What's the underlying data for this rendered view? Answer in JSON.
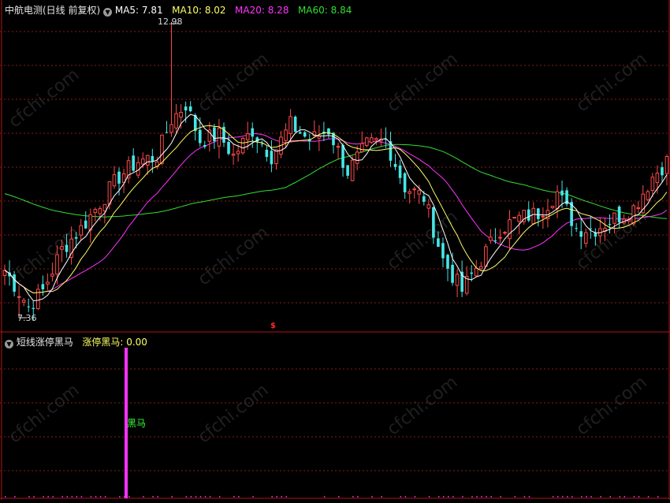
{
  "colors": {
    "background": "#000000",
    "grid": "#8a1c1c",
    "divider": "#b01515",
    "candle_up": "#ff4a4a",
    "candle_down": "#46e6e6",
    "ma5": "#ffffff",
    "ma10": "#ffff66",
    "ma20": "#ff33ff",
    "ma60": "#33dd33",
    "signal_bar": "#ff33ff",
    "signal_text": "#33ff33",
    "marker": "#ff2a2a",
    "watermark": "#3a3a3a"
  },
  "main_panel": {
    "stock_name": "中航电测(日线 前复权)",
    "ma5": {
      "label": "MA5:",
      "value": "7.81"
    },
    "ma10": {
      "label": "MA10:",
      "value": "8.02"
    },
    "ma20": {
      "label": "MA20:",
      "value": "8.28"
    },
    "ma60": {
      "label": "MA60:",
      "value": "8.84"
    },
    "high_label": "12.98",
    "low_label": "7.36",
    "event_marker": "$",
    "control_icon": "chevron-down-icon"
  },
  "sub_panel": {
    "indicator_name": "短线涨停黑马",
    "series_label": "涨停黑马:",
    "series_value": "0.00",
    "signal_text": "黑马",
    "control_icon": "chevron-down-icon"
  },
  "watermark": "cfchi.com",
  "chart_data": {
    "type": "candlestick",
    "price_range": [
      7.36,
      12.98
    ],
    "series_names": [
      "MA5",
      "MA10",
      "MA20",
      "MA60"
    ],
    "annotations": [
      {
        "text": "12.98",
        "kind": "period-high"
      },
      {
        "text": "7.36",
        "kind": "period-low"
      }
    ]
  }
}
